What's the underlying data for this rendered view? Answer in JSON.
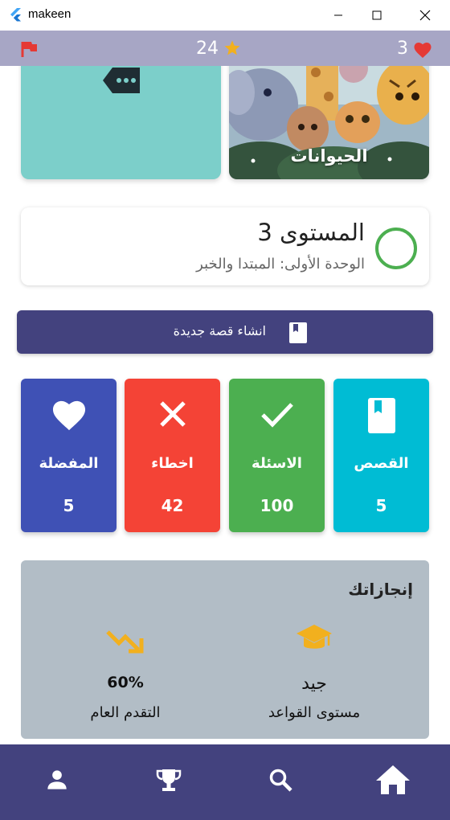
{
  "window": {
    "title": "makeen"
  },
  "status": {
    "stars": "24",
    "lives": "3"
  },
  "categories": [
    {
      "label": ""
    },
    {
      "label": "الحيوانات"
    }
  ],
  "level": {
    "title": "المستوى 3",
    "subtitle": "الوحدة الأولى: المبتدا والخبر",
    "progress": 0
  },
  "create_story": {
    "label": "انشاء قصة جديدة"
  },
  "stats": [
    {
      "label": "المفضلة",
      "value": "5",
      "color": "#3f51b5",
      "icon": "heart-icon"
    },
    {
      "label": "اخطاء",
      "value": "42",
      "color": "#f44336",
      "icon": "close-icon"
    },
    {
      "label": "الاسئلة",
      "value": "100",
      "color": "#4caf50",
      "icon": "check-icon"
    },
    {
      "label": "القصص",
      "value": "5",
      "color": "#00bcd4",
      "icon": "book-icon"
    }
  ],
  "achievements": {
    "title": "إنجازاتك",
    "grammar": {
      "value": "جيد",
      "label": "مستوى القواعد"
    },
    "progress": {
      "value": "60%",
      "label": "التقدم العام"
    }
  },
  "nav": [
    "person-icon",
    "trophy-icon",
    "search-icon",
    "home-icon"
  ],
  "colors": {
    "primary": "#43427e",
    "status_bar": "#a7a6c5",
    "accent": "#f2b01e",
    "teal": "#7ccfca"
  }
}
